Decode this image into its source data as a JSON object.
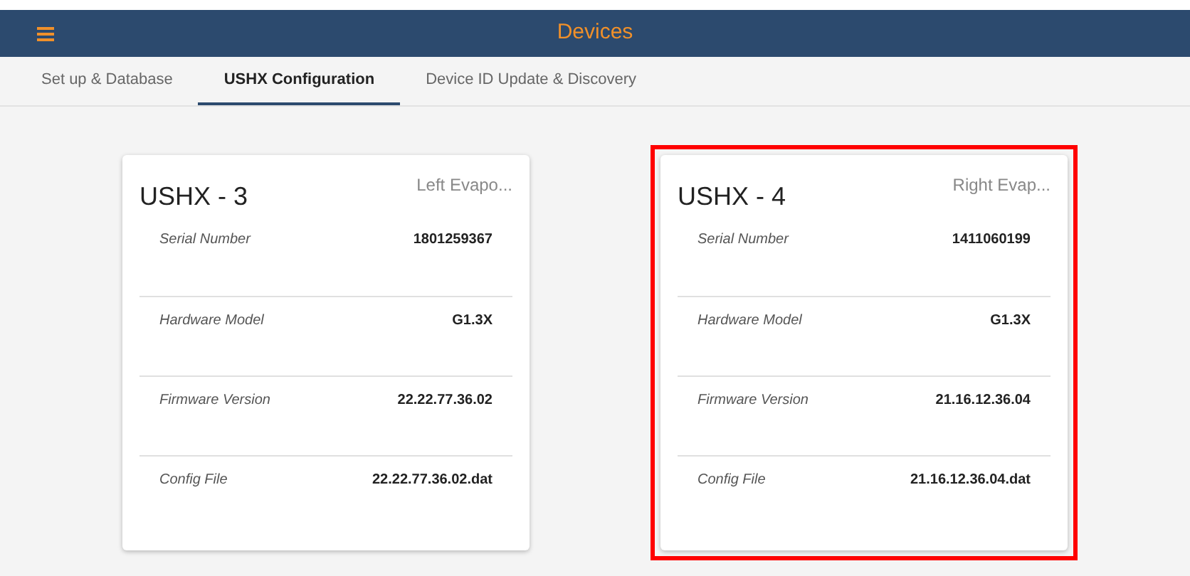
{
  "header": {
    "title": "Devices"
  },
  "tabs": [
    {
      "label": "Set up & Database",
      "selected": false
    },
    {
      "label": "USHX Configuration",
      "selected": true
    },
    {
      "label": "Device ID Update & Discovery",
      "selected": false
    }
  ],
  "cards": [
    {
      "title": "USHX - 3",
      "subtitle": "Left Evapo...",
      "highlighted": false,
      "fields": [
        {
          "label": "Serial Number",
          "value": "1801259367"
        },
        {
          "label": "Hardware Model",
          "value": "G1.3X"
        },
        {
          "label": "Firmware Version",
          "value": "22.22.77.36.02"
        },
        {
          "label": "Config File",
          "value": "22.22.77.36.02.dat"
        }
      ]
    },
    {
      "title": "USHX - 4",
      "subtitle": "Right Evap...",
      "highlighted": true,
      "fields": [
        {
          "label": "Serial Number",
          "value": "1411060199"
        },
        {
          "label": "Hardware Model",
          "value": "G1.3X"
        },
        {
          "label": "Firmware Version",
          "value": "21.16.12.36.04"
        },
        {
          "label": "Config File",
          "value": "21.16.12.36.04.dat"
        }
      ]
    }
  ]
}
